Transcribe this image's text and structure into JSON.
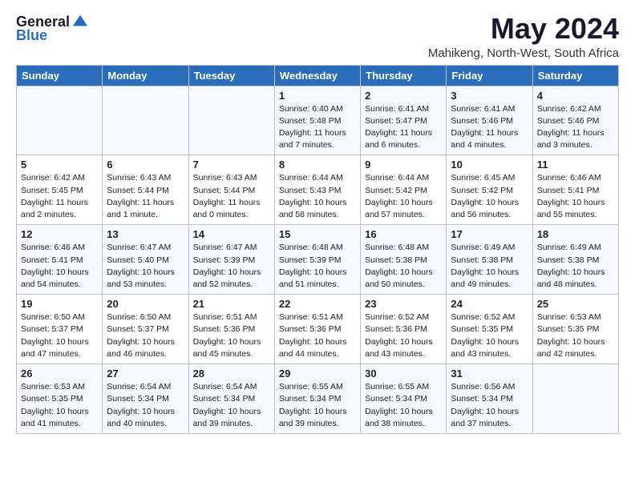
{
  "logo": {
    "general": "General",
    "blue": "Blue"
  },
  "title": "May 2024",
  "location": "Mahikeng, North-West, South Africa",
  "days_header": [
    "Sunday",
    "Monday",
    "Tuesday",
    "Wednesday",
    "Thursday",
    "Friday",
    "Saturday"
  ],
  "weeks": [
    [
      {
        "day": "",
        "info": ""
      },
      {
        "day": "",
        "info": ""
      },
      {
        "day": "",
        "info": ""
      },
      {
        "day": "1",
        "info": "Sunrise: 6:40 AM\nSunset: 5:48 PM\nDaylight: 11 hours\nand 7 minutes."
      },
      {
        "day": "2",
        "info": "Sunrise: 6:41 AM\nSunset: 5:47 PM\nDaylight: 11 hours\nand 6 minutes."
      },
      {
        "day": "3",
        "info": "Sunrise: 6:41 AM\nSunset: 5:46 PM\nDaylight: 11 hours\nand 4 minutes."
      },
      {
        "day": "4",
        "info": "Sunrise: 6:42 AM\nSunset: 5:46 PM\nDaylight: 11 hours\nand 3 minutes."
      }
    ],
    [
      {
        "day": "5",
        "info": "Sunrise: 6:42 AM\nSunset: 5:45 PM\nDaylight: 11 hours\nand 2 minutes."
      },
      {
        "day": "6",
        "info": "Sunrise: 6:43 AM\nSunset: 5:44 PM\nDaylight: 11 hours\nand 1 minute."
      },
      {
        "day": "7",
        "info": "Sunrise: 6:43 AM\nSunset: 5:44 PM\nDaylight: 11 hours\nand 0 minutes."
      },
      {
        "day": "8",
        "info": "Sunrise: 6:44 AM\nSunset: 5:43 PM\nDaylight: 10 hours\nand 58 minutes."
      },
      {
        "day": "9",
        "info": "Sunrise: 6:44 AM\nSunset: 5:42 PM\nDaylight: 10 hours\nand 57 minutes."
      },
      {
        "day": "10",
        "info": "Sunrise: 6:45 AM\nSunset: 5:42 PM\nDaylight: 10 hours\nand 56 minutes."
      },
      {
        "day": "11",
        "info": "Sunrise: 6:46 AM\nSunset: 5:41 PM\nDaylight: 10 hours\nand 55 minutes."
      }
    ],
    [
      {
        "day": "12",
        "info": "Sunrise: 6:46 AM\nSunset: 5:41 PM\nDaylight: 10 hours\nand 54 minutes."
      },
      {
        "day": "13",
        "info": "Sunrise: 6:47 AM\nSunset: 5:40 PM\nDaylight: 10 hours\nand 53 minutes."
      },
      {
        "day": "14",
        "info": "Sunrise: 6:47 AM\nSunset: 5:39 PM\nDaylight: 10 hours\nand 52 minutes."
      },
      {
        "day": "15",
        "info": "Sunrise: 6:48 AM\nSunset: 5:39 PM\nDaylight: 10 hours\nand 51 minutes."
      },
      {
        "day": "16",
        "info": "Sunrise: 6:48 AM\nSunset: 5:38 PM\nDaylight: 10 hours\nand 50 minutes."
      },
      {
        "day": "17",
        "info": "Sunrise: 6:49 AM\nSunset: 5:38 PM\nDaylight: 10 hours\nand 49 minutes."
      },
      {
        "day": "18",
        "info": "Sunrise: 6:49 AM\nSunset: 5:38 PM\nDaylight: 10 hours\nand 48 minutes."
      }
    ],
    [
      {
        "day": "19",
        "info": "Sunrise: 6:50 AM\nSunset: 5:37 PM\nDaylight: 10 hours\nand 47 minutes."
      },
      {
        "day": "20",
        "info": "Sunrise: 6:50 AM\nSunset: 5:37 PM\nDaylight: 10 hours\nand 46 minutes."
      },
      {
        "day": "21",
        "info": "Sunrise: 6:51 AM\nSunset: 5:36 PM\nDaylight: 10 hours\nand 45 minutes."
      },
      {
        "day": "22",
        "info": "Sunrise: 6:51 AM\nSunset: 5:36 PM\nDaylight: 10 hours\nand 44 minutes."
      },
      {
        "day": "23",
        "info": "Sunrise: 6:52 AM\nSunset: 5:36 PM\nDaylight: 10 hours\nand 43 minutes."
      },
      {
        "day": "24",
        "info": "Sunrise: 6:52 AM\nSunset: 5:35 PM\nDaylight: 10 hours\nand 43 minutes."
      },
      {
        "day": "25",
        "info": "Sunrise: 6:53 AM\nSunset: 5:35 PM\nDaylight: 10 hours\nand 42 minutes."
      }
    ],
    [
      {
        "day": "26",
        "info": "Sunrise: 6:53 AM\nSunset: 5:35 PM\nDaylight: 10 hours\nand 41 minutes."
      },
      {
        "day": "27",
        "info": "Sunrise: 6:54 AM\nSunset: 5:34 PM\nDaylight: 10 hours\nand 40 minutes."
      },
      {
        "day": "28",
        "info": "Sunrise: 6:54 AM\nSunset: 5:34 PM\nDaylight: 10 hours\nand 39 minutes."
      },
      {
        "day": "29",
        "info": "Sunrise: 6:55 AM\nSunset: 5:34 PM\nDaylight: 10 hours\nand 39 minutes."
      },
      {
        "day": "30",
        "info": "Sunrise: 6:55 AM\nSunset: 5:34 PM\nDaylight: 10 hours\nand 38 minutes."
      },
      {
        "day": "31",
        "info": "Sunrise: 6:56 AM\nSunset: 5:34 PM\nDaylight: 10 hours\nand 37 minutes."
      },
      {
        "day": "",
        "info": ""
      }
    ]
  ]
}
